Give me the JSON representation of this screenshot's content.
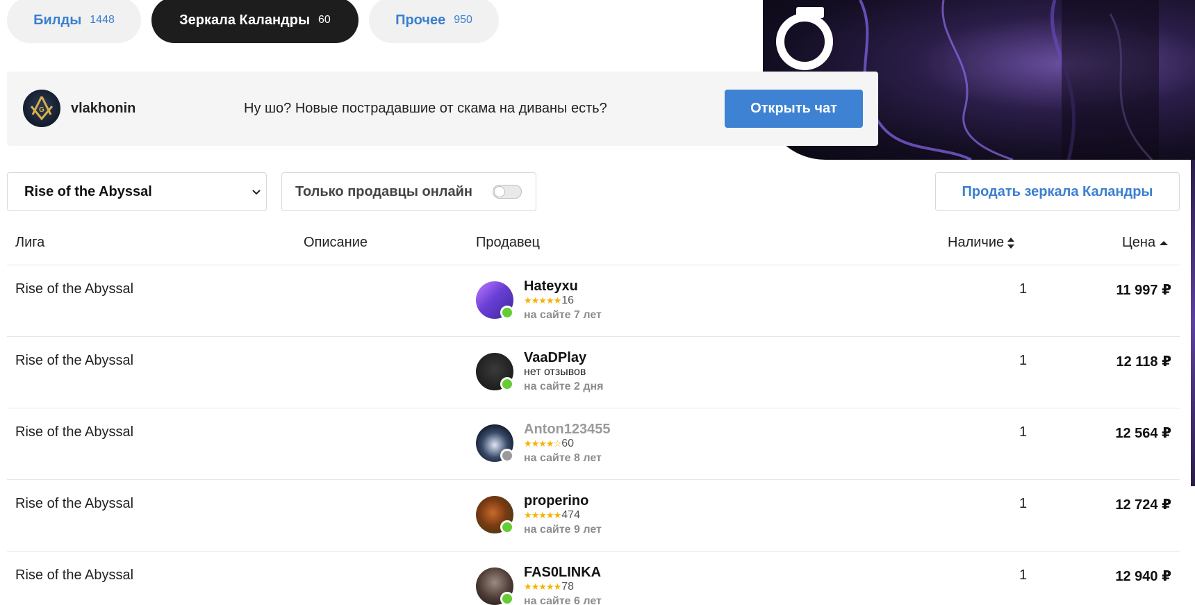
{
  "tabs": [
    {
      "label": "Билды",
      "count": "1448",
      "active": false
    },
    {
      "label": "Зеркала Каландры",
      "count": "60",
      "active": true
    },
    {
      "label": "Прочее",
      "count": "950",
      "active": false
    }
  ],
  "chat": {
    "username": "vlakhonin",
    "message": "Ну шо? Новые пострадавшие от скама на диваны есть?",
    "open_button": "Открыть чат"
  },
  "filters": {
    "league_selected": "Rise of the Abyssal",
    "online_only_label": "Только продавцы онлайн",
    "online_only_on": false,
    "sell_button": "Продать зеркала Каландры"
  },
  "table": {
    "headers": {
      "league": "Лига",
      "description": "Описание",
      "seller": "Продавец",
      "stock": "Наличие",
      "price": "Цена"
    },
    "rows": [
      {
        "league": "Rise of the Abyssal",
        "seller": "Hateyxu",
        "rating_stars": 5,
        "reviews": "16",
        "since": "на сайте 7 лет",
        "online": true,
        "stock": "1",
        "price": "11 997 ₽"
      },
      {
        "league": "Rise of the Abyssal",
        "seller": "VaaDPlay",
        "rating_stars": 0,
        "reviews": "нет отзывов",
        "since": "на сайте 2 дня",
        "online": true,
        "stock": "1",
        "price": "12 118 ₽"
      },
      {
        "league": "Rise of the Abyssal",
        "seller": "Anton123455",
        "rating_stars": 4,
        "reviews": "60",
        "since": "на сайте 8 лет",
        "online": false,
        "stock": "1",
        "price": "12 564 ₽"
      },
      {
        "league": "Rise of the Abyssal",
        "seller": "properino",
        "rating_stars": 5,
        "reviews": "474",
        "since": "на сайте 9 лет",
        "online": true,
        "stock": "1",
        "price": "12 724 ₽"
      },
      {
        "league": "Rise of the Abyssal",
        "seller": "FAS0LINKA",
        "rating_stars": 5,
        "reviews": "78",
        "since": "на сайте 6 лет",
        "online": true,
        "stock": "1",
        "price": "12 940 ₽"
      }
    ]
  },
  "colors": {
    "accent": "#3e82d4",
    "online": "#66cc33",
    "offline": "#9a9a9a",
    "star": "#f5b301"
  }
}
